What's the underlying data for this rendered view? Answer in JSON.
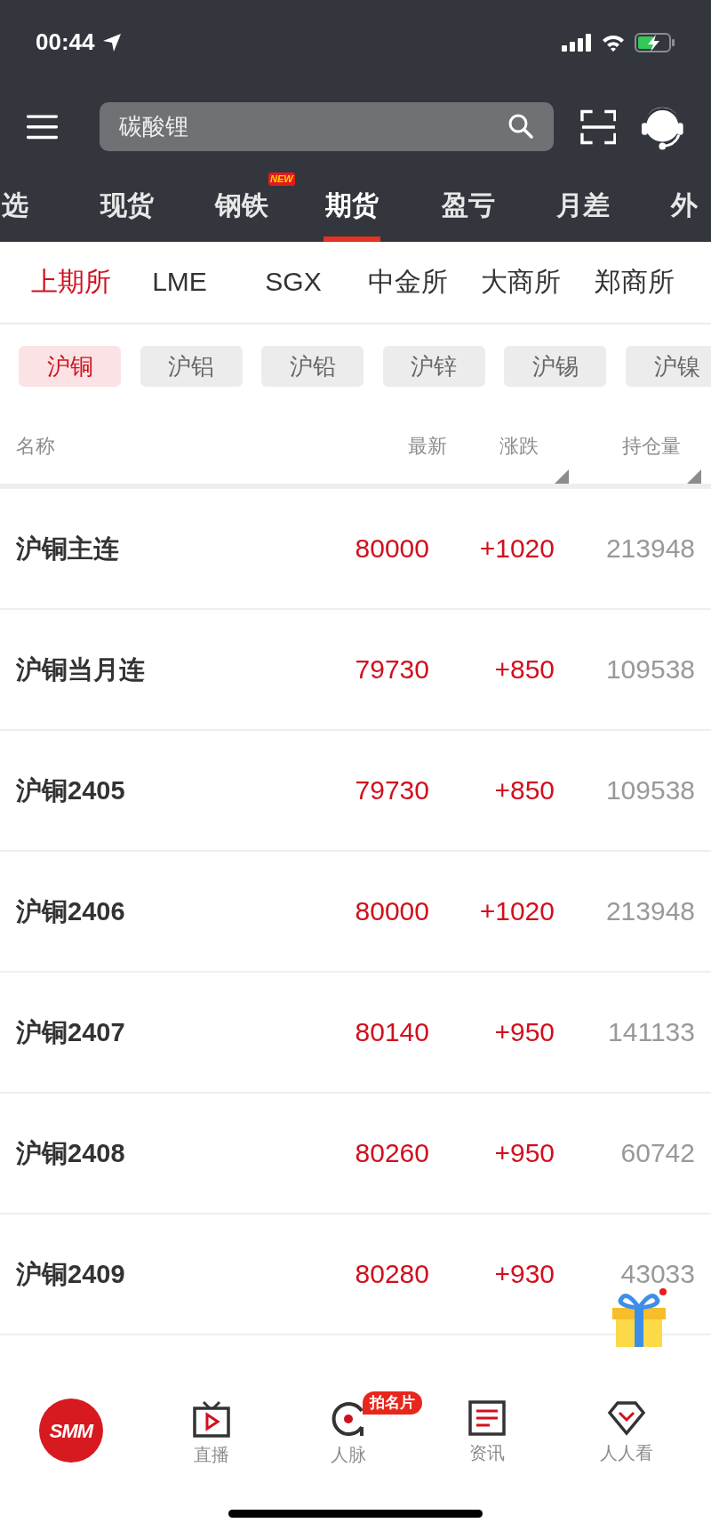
{
  "status_bar": {
    "time": "00:44"
  },
  "search": {
    "placeholder": "碳酸锂"
  },
  "category_tabs": [
    {
      "label": "选",
      "selected": false
    },
    {
      "label": "现货",
      "selected": false
    },
    {
      "label": "钢铁",
      "selected": false,
      "badge": "NEW"
    },
    {
      "label": "期货",
      "selected": true
    },
    {
      "label": "盈亏",
      "selected": false
    },
    {
      "label": "月差",
      "selected": false
    },
    {
      "label": "外",
      "selected": false
    }
  ],
  "exchange_tabs": [
    {
      "label": "上期所",
      "selected": true
    },
    {
      "label": "LME",
      "selected": false
    },
    {
      "label": "SGX",
      "selected": false
    },
    {
      "label": "中金所",
      "selected": false
    },
    {
      "label": "大商所",
      "selected": false
    },
    {
      "label": "郑商所",
      "selected": false
    }
  ],
  "product_chips": [
    {
      "label": "沪铜",
      "selected": true
    },
    {
      "label": "沪铝",
      "selected": false
    },
    {
      "label": "沪铅",
      "selected": false
    },
    {
      "label": "沪锌",
      "selected": false
    },
    {
      "label": "沪锡",
      "selected": false
    },
    {
      "label": "沪镍",
      "selected": false
    }
  ],
  "table": {
    "columns": [
      {
        "label": "名称",
        "sortable": false
      },
      {
        "label": "最新",
        "sortable": false
      },
      {
        "label": "涨跌",
        "sortable": true
      },
      {
        "label": "持仓量",
        "sortable": true
      }
    ],
    "rows": [
      {
        "name": "沪铜主连",
        "latest": "80000",
        "change": "+1020",
        "open_interest": "213948"
      },
      {
        "name": "沪铜当月连",
        "latest": "79730",
        "change": "+850",
        "open_interest": "109538"
      },
      {
        "name": "沪铜2405",
        "latest": "79730",
        "change": "+850",
        "open_interest": "109538"
      },
      {
        "name": "沪铜2406",
        "latest": "80000",
        "change": "+1020",
        "open_interest": "213948"
      },
      {
        "name": "沪铜2407",
        "latest": "80140",
        "change": "+950",
        "open_interest": "141133"
      },
      {
        "name": "沪铜2408",
        "latest": "80260",
        "change": "+950",
        "open_interest": "60742"
      },
      {
        "name": "沪铜2409",
        "latest": "80280",
        "change": "+930",
        "open_interest": "43033"
      }
    ]
  },
  "bottom_nav": [
    {
      "kind": "logo",
      "label": "SMM"
    },
    {
      "kind": "live",
      "label": "直播"
    },
    {
      "kind": "contacts",
      "label": "人脉",
      "badge": "拍名片"
    },
    {
      "kind": "news",
      "label": "资讯"
    },
    {
      "kind": "watch",
      "label": "人人看"
    }
  ]
}
